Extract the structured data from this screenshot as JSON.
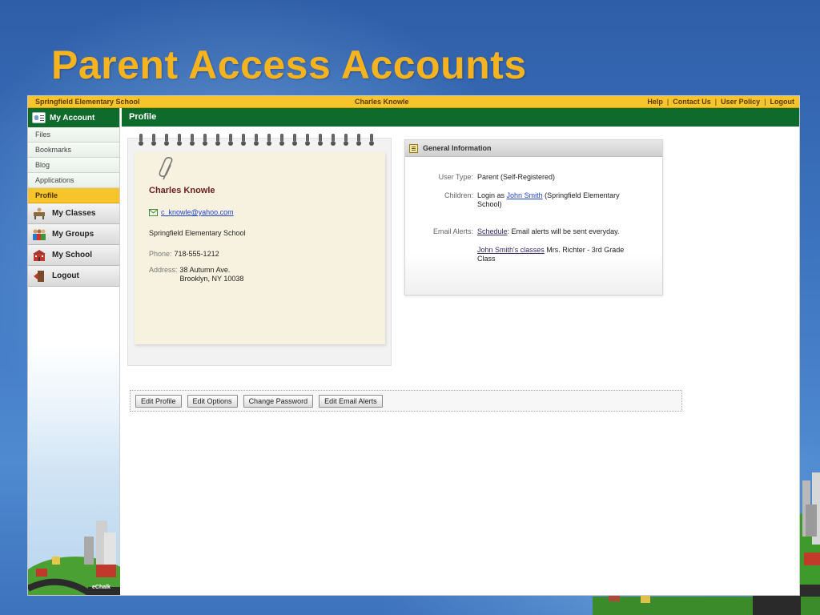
{
  "slide": {
    "title": "Parent Access Accounts"
  },
  "topbar": {
    "school": "Springfield Elementary School",
    "user": "Charles Knowle",
    "links": [
      "Help",
      "Contact Us",
      "User Policy",
      "Logout"
    ]
  },
  "sidebar": {
    "account_label": "My Account",
    "subitems": [
      "Files",
      "Bookmarks",
      "Blog",
      "Applications",
      "Profile"
    ],
    "nav": [
      "My Classes",
      "My Groups",
      "My School",
      "Logout"
    ],
    "brand": "eChalk"
  },
  "main": {
    "section_title": "Profile",
    "profile": {
      "name": "Charles Knowle",
      "email": "c_knowle@yahoo.com",
      "school": "Springfield Elementary School",
      "phone_label": "Phone:",
      "phone": "718-555-1212",
      "address_label": "Address:",
      "address_line1": "38 Autumn Ave.",
      "address_line2": "Brooklyn, NY 10038"
    },
    "general_info": {
      "title": "General Information",
      "user_type_label": "User Type:",
      "user_type": "Parent (Self-Registered)",
      "children_label": "Children:",
      "children_prefix": "Login as",
      "children_link": "John Smith",
      "children_suffix": "(Springfield Elementary School)",
      "email_alerts_label": "Email Alerts:",
      "alert1_link": "Schedule",
      "alert1_text": ": Email alerts will be sent everyday.",
      "alert2_link": "John Smith's classes",
      "alert2_text": "Mrs. Richter - 3rd Grade Class"
    },
    "buttons": [
      "Edit Profile",
      "Edit Options",
      "Change Password",
      "Edit Email Alerts"
    ]
  },
  "colors": {
    "accent_yellow": "#f7c52b",
    "header_green": "#0f6b2c",
    "title_orange": "#f6b320"
  }
}
